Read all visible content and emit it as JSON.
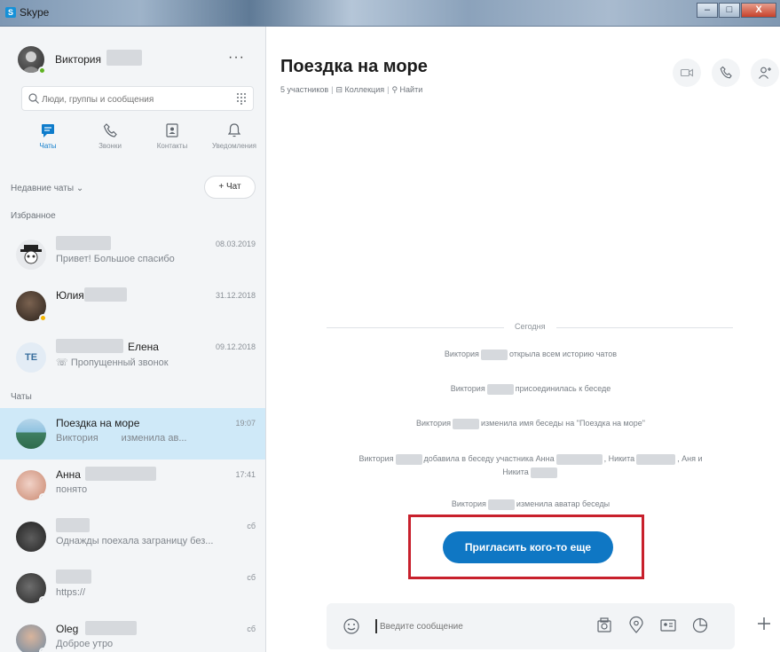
{
  "window": {
    "title": "Skype",
    "badge": "S",
    "controls": [
      "–",
      "□",
      "X"
    ]
  },
  "profile": {
    "name": "Виктория",
    "more": "···"
  },
  "search": {
    "placeholder": "Люди, группы и сообщения"
  },
  "nav": [
    {
      "label": "Чаты",
      "icon": "chat-icon",
      "active": true
    },
    {
      "label": "Звонки",
      "icon": "phone-icon",
      "active": false
    },
    {
      "label": "Контакты",
      "icon": "contacts-icon",
      "active": false
    },
    {
      "label": "Уведомления",
      "icon": "bell-icon",
      "active": false
    }
  ],
  "recent": {
    "label": "Недавние чаты",
    "new_chat": "+ Чат"
  },
  "sections": {
    "favorites": "Избранное",
    "chats": "Чаты"
  },
  "favorites": [
    {
      "name": "",
      "preview": "Привет! Большое спасибо",
      "time": "08.03.2019"
    },
    {
      "name": "Юлия",
      "preview": "",
      "time": "31.12.2018"
    },
    {
      "name": "Елена",
      "initials": "TE",
      "preview": "Пропущенный звонок",
      "time": "09.12.2018"
    }
  ],
  "chats": [
    {
      "name": "Поездка на море",
      "preview": "Виктория",
      "preview_tail": "изменила ав...",
      "time": "19:07"
    },
    {
      "name": "Анна",
      "preview": "понято",
      "time": "17:41"
    },
    {
      "name": "",
      "preview": "Однажды поехала заграницу без...",
      "time": "сб"
    },
    {
      "name": "",
      "preview": "https://",
      "time": "сб"
    },
    {
      "name": "Oleg",
      "preview": "Доброе утро",
      "time": "сб"
    }
  ],
  "conversation": {
    "title": "Поездка на море",
    "participants": "5 участников",
    "gallery": "Коллекция",
    "find": "Найти",
    "day": "Сегодня",
    "messages": {
      "m1_a": "Виктория",
      "m1_b": "открыла всем историю чатов",
      "m2_a": "Виктория",
      "m2_b": "присоединилась к беседе",
      "m3_a": "Виктория",
      "m3_b": "изменила имя беседы на \"Поездка на море\"",
      "m4_a": "Виктория",
      "m4_b": "добавила в беседу участника Анна",
      "m4_c": ", Никита",
      "m4_d": ", Аня и",
      "m4_e": "Никита",
      "m5_a": "Виктория",
      "m5_b": "изменила аватар беседы"
    },
    "invite_button": "Пригласить кого-то еще",
    "composer_placeholder": "Введите сообщение"
  },
  "colors": {
    "accent": "#0f77c4",
    "selected_row": "#cfe9f8",
    "highlight_frame": "#c8202c",
    "online": "#5fb322",
    "away": "#f5b400"
  }
}
